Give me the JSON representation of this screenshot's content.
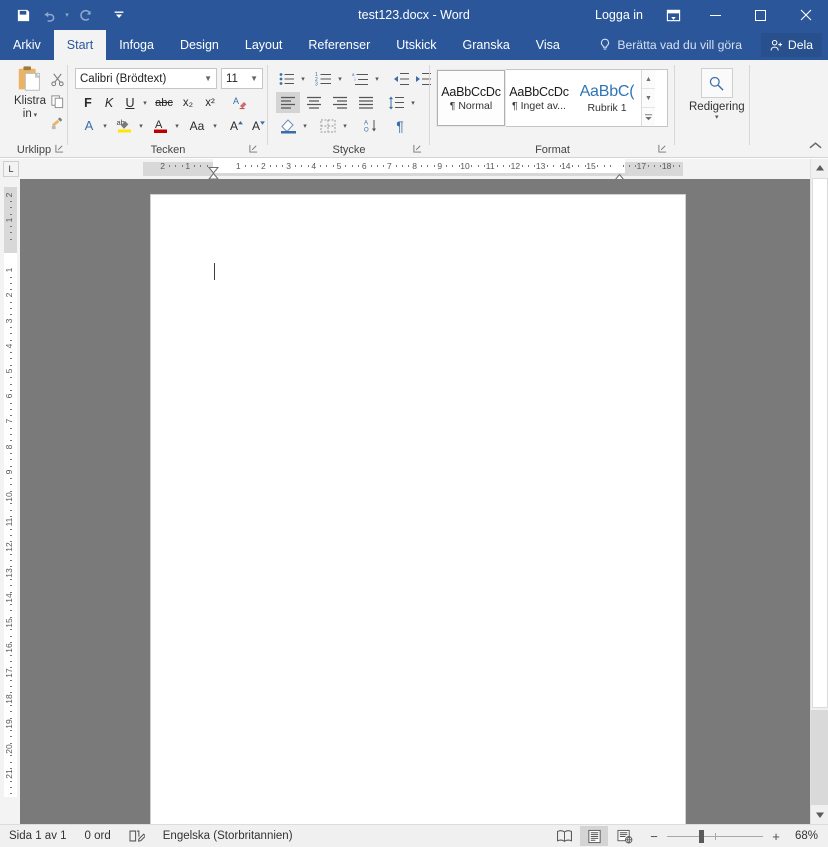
{
  "window": {
    "title": "test123.docx  -  Word",
    "sign_in": "Logga in",
    "quick_access": [
      {
        "name": "save-icon",
        "label": "Spara"
      },
      {
        "name": "undo-icon",
        "label": "Ångra"
      },
      {
        "name": "redo-icon",
        "label": "Gör om"
      },
      {
        "name": "customize-qat-icon",
        "label": "Anpassa verktygsfältet Snabbåtkomst"
      }
    ],
    "controls": {
      "ribbon_display": "Alternativ för menyfliksområdet",
      "minimize": "–",
      "maximize": "□",
      "close": "✕"
    }
  },
  "ribbon_tabs": [
    {
      "label": "Arkiv",
      "active": false
    },
    {
      "label": "Start",
      "active": true
    },
    {
      "label": "Infoga",
      "active": false
    },
    {
      "label": "Design",
      "active": false
    },
    {
      "label": "Layout",
      "active": false
    },
    {
      "label": "Referenser",
      "active": false
    },
    {
      "label": "Utskick",
      "active": false
    },
    {
      "label": "Granska",
      "active": false
    },
    {
      "label": "Visa",
      "active": false
    }
  ],
  "tell_me": "Berätta vad du vill göra",
  "share": "Dela",
  "groups": {
    "clipboard": {
      "label": "Urklipp",
      "paste_label_line1": "Klistra",
      "paste_label_line2": "in",
      "buttons": [
        "Klipp ut",
        "Kopiera",
        "Hämta format"
      ]
    },
    "font": {
      "label": "Tecken",
      "font_name": "Calibri (Brödtext)",
      "font_size": "11",
      "bold": "F",
      "italic": "K",
      "underline": "U",
      "strikethrough": "abc",
      "subscript": "x₂",
      "superscript": "x²",
      "clear_formatting": "Ta bort all formatering",
      "text_effects": "A",
      "highlight": "ab",
      "font_color": "A",
      "change_case": "Aa",
      "grow_font": "A",
      "shrink_font": "A"
    },
    "paragraph": {
      "label": "Stycke",
      "bullets": "Punktlista",
      "numbering": "Numrerad lista",
      "multilevel": "Listbibliotek",
      "decrease_indent": "Minska indrag",
      "increase_indent": "Öka indrag",
      "align_left": "Vänsterjustera",
      "align_center": "Centrera",
      "align_right": "Högerjustera",
      "justify": "Marginaljustera",
      "line_spacing": "Radavstånd",
      "shading": "Fyllning",
      "borders": "Kantlinjer",
      "sort": "Sortera",
      "show_marks": "¶"
    },
    "styles": {
      "label": "Format",
      "items": [
        {
          "preview": "AaBbCcDc",
          "name": "¶ Normal",
          "active": true,
          "heading": false
        },
        {
          "preview": "AaBbCcDc",
          "name": "¶ Inget av...",
          "active": false,
          "heading": false
        },
        {
          "preview": "AaBbC(",
          "name": "Rubrik 1",
          "active": false,
          "heading": true
        }
      ],
      "scroll_up": "▲",
      "scroll_down": "▼",
      "more": "▼"
    },
    "editing": {
      "label": "Redigering",
      "icon": "search-icon",
      "caret": "▾"
    }
  },
  "collapse_ribbon": "^",
  "ruler": {
    "tab_selector": "L",
    "horizontal_labels": [
      "2",
      "1",
      "1",
      "2",
      "3",
      "4",
      "5",
      "6",
      "7",
      "8",
      "9",
      "10",
      "11",
      "12",
      "13",
      "14",
      "15",
      "17",
      "18"
    ],
    "vertical_labels": [
      "2",
      "1",
      "1",
      "2",
      "3",
      "4",
      "5",
      "6",
      "7",
      "8",
      "9",
      "10",
      "11",
      "12",
      "13",
      "14",
      "15",
      "16",
      "17",
      "18",
      "19"
    ]
  },
  "document": {
    "cursor_visible": true,
    "content": ""
  },
  "status": {
    "page": "Sida 1 av 1",
    "words": "0 ord",
    "proofing_icon": "proofing-errors-icon",
    "language": "Engelska (Storbritannien)",
    "views": [
      {
        "name": "read-mode",
        "label": "Läsläge",
        "active": false
      },
      {
        "name": "print-layout",
        "label": "Utskriftslayout",
        "active": true
      },
      {
        "name": "web-layout",
        "label": "Webblayout",
        "active": false
      }
    ],
    "zoom_out": "−",
    "zoom_in": "+",
    "zoom_percent": "68%"
  },
  "colors": {
    "word_blue": "#2b579a",
    "ribbon_bg": "#f3f3f3",
    "share_bg": "#28508c",
    "heading_blue": "#2e74b5",
    "doc_bg": "#7a7a7a"
  }
}
